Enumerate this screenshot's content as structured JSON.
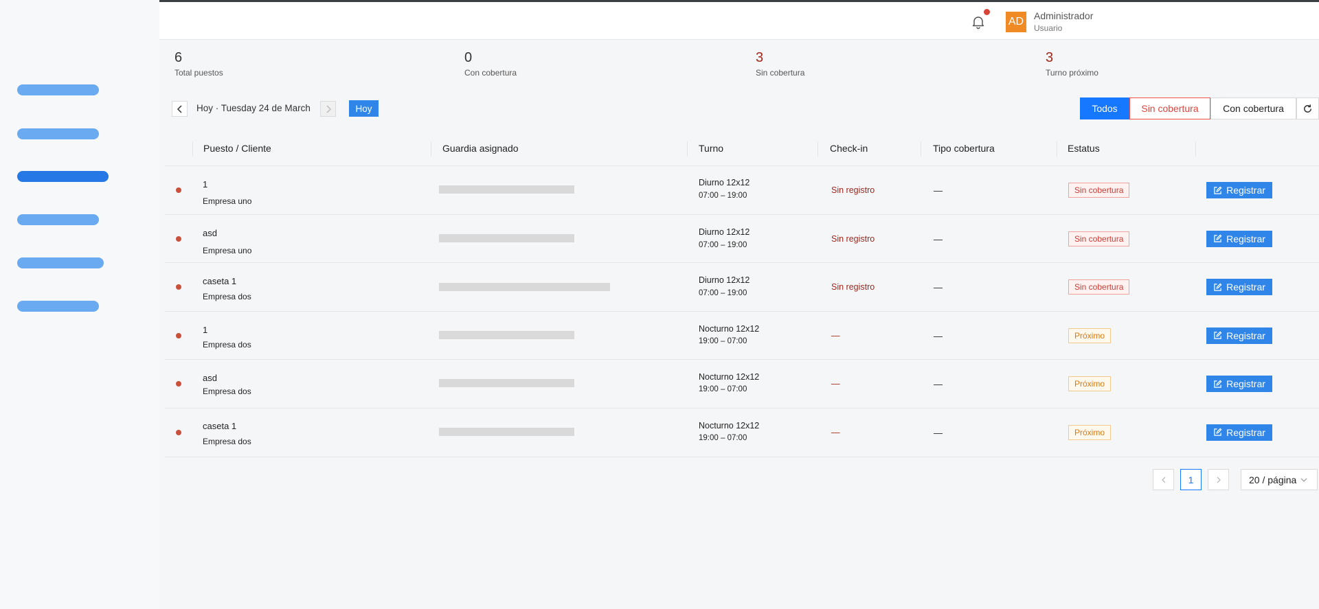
{
  "header": {
    "user_initials": "AD",
    "user_name": "Administrador",
    "user_role": "Usuario"
  },
  "stats": [
    {
      "value": "6",
      "label": "Total puestos"
    },
    {
      "value": "0",
      "label": "Con cobertura"
    },
    {
      "value": "3",
      "label": "Sin cobertura"
    },
    {
      "value": "3",
      "label": "Turno próximo"
    }
  ],
  "date_nav": {
    "label": "Hoy · Tuesday 24 de March",
    "today_label": "Hoy"
  },
  "filters": [
    {
      "label": "Todos",
      "selected": true
    },
    {
      "label": "Sin cobertura",
      "selected": false
    },
    {
      "label": "Con cobertura",
      "selected": false
    }
  ],
  "table": {
    "columns": [
      "Puesto / Cliente",
      "Guardia asignado",
      "Turno",
      "Check-in",
      "Tipo cobertura",
      "Estatus"
    ],
    "rows": [
      {
        "post": "1",
        "client": "Empresa uno",
        "shift": "Diurno 12x12",
        "time": "07:00 – 19:00",
        "checkin": "Sin registro",
        "coverage": "—",
        "status": "Sin cobertura",
        "action": "Registrar"
      },
      {
        "post": "asd",
        "client": "Empresa uno",
        "shift": "Diurno 12x12",
        "time": "07:00 – 19:00",
        "checkin": "Sin registro",
        "coverage": "—",
        "status": "Sin cobertura",
        "action": "Registrar"
      },
      {
        "post": "caseta 1",
        "client": "Empresa dos",
        "shift": "Diurno 12x12",
        "time": "07:00 – 19:00",
        "checkin": "Sin registro",
        "coverage": "—",
        "status": "Sin cobertura",
        "action": "Registrar"
      },
      {
        "post": "1",
        "client": "Empresa dos",
        "shift": "Nocturno 12x12",
        "time": "19:00 – 07:00",
        "checkin": "—",
        "coverage": "—",
        "status": "Próximo",
        "action": "Registrar"
      },
      {
        "post": "asd",
        "client": "Empresa dos",
        "shift": "Nocturno 12x12",
        "time": "19:00 – 07:00",
        "checkin": "—",
        "coverage": "—",
        "status": "Próximo",
        "action": "Registrar"
      },
      {
        "post": "caseta 1",
        "client": "Empresa dos",
        "shift": "Nocturno 12x12",
        "time": "19:00 – 07:00",
        "checkin": "—",
        "coverage": "—",
        "status": "Próximo",
        "action": "Registrar"
      }
    ]
  },
  "pagination": {
    "current_page": "1",
    "page_size": "20 / página"
  },
  "colors": {
    "primary": "#1677ff",
    "danger": "#cc3a33",
    "warning": "#d87a14",
    "avatar": "#f08a24"
  }
}
